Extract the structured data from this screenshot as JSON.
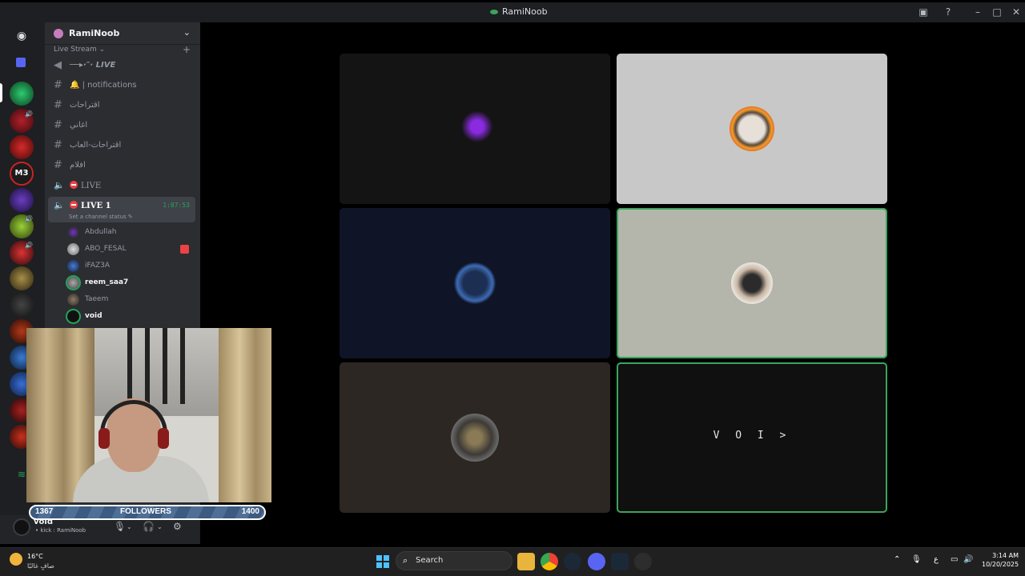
{
  "window": {
    "title": "RamiNoob"
  },
  "server": {
    "name": "RamiNoob",
    "category": "Live Stream"
  },
  "channels": [
    {
      "type": "announce",
      "label": "──▸·″· LIVE"
    },
    {
      "type": "text",
      "label": "🔔 | notifications"
    },
    {
      "type": "text",
      "label": "اقتراحات"
    },
    {
      "type": "text",
      "label": "اغاني"
    },
    {
      "type": "text",
      "label": "اقتراحات-العاب"
    },
    {
      "type": "text",
      "label": "افلام"
    },
    {
      "type": "voice",
      "label": "LIVE"
    },
    {
      "type": "voice",
      "label": "LIVE 1",
      "timer": "1:07:53",
      "status": "Set a channel status ✎"
    }
  ],
  "voice_users": [
    {
      "name": "Abdullah"
    },
    {
      "name": "ABO_FESAL"
    },
    {
      "name": "iFAZ3A"
    },
    {
      "name": "reem_saa7"
    },
    {
      "name": "Taeem"
    },
    {
      "name": "void"
    }
  ],
  "user_panel": {
    "name": "void",
    "status": "• kick : RamiNoob"
  },
  "stage": {
    "void_tile_text": "V O I >"
  },
  "overlay": {
    "followers_label": "FOLLOWERS",
    "current": "1367",
    "goal": "1400"
  },
  "taskbar": {
    "temp": "16°C",
    "condition": "صافٍ غالبًا",
    "search": "Search",
    "time": "3:14 AM",
    "date": "10/20/2025",
    "lang": "ع"
  },
  "colors": {
    "accent_green": "#3ba55c",
    "live_red": "#ed4245",
    "sidebar": "#2b2d31",
    "rail": "#1e1f22"
  }
}
